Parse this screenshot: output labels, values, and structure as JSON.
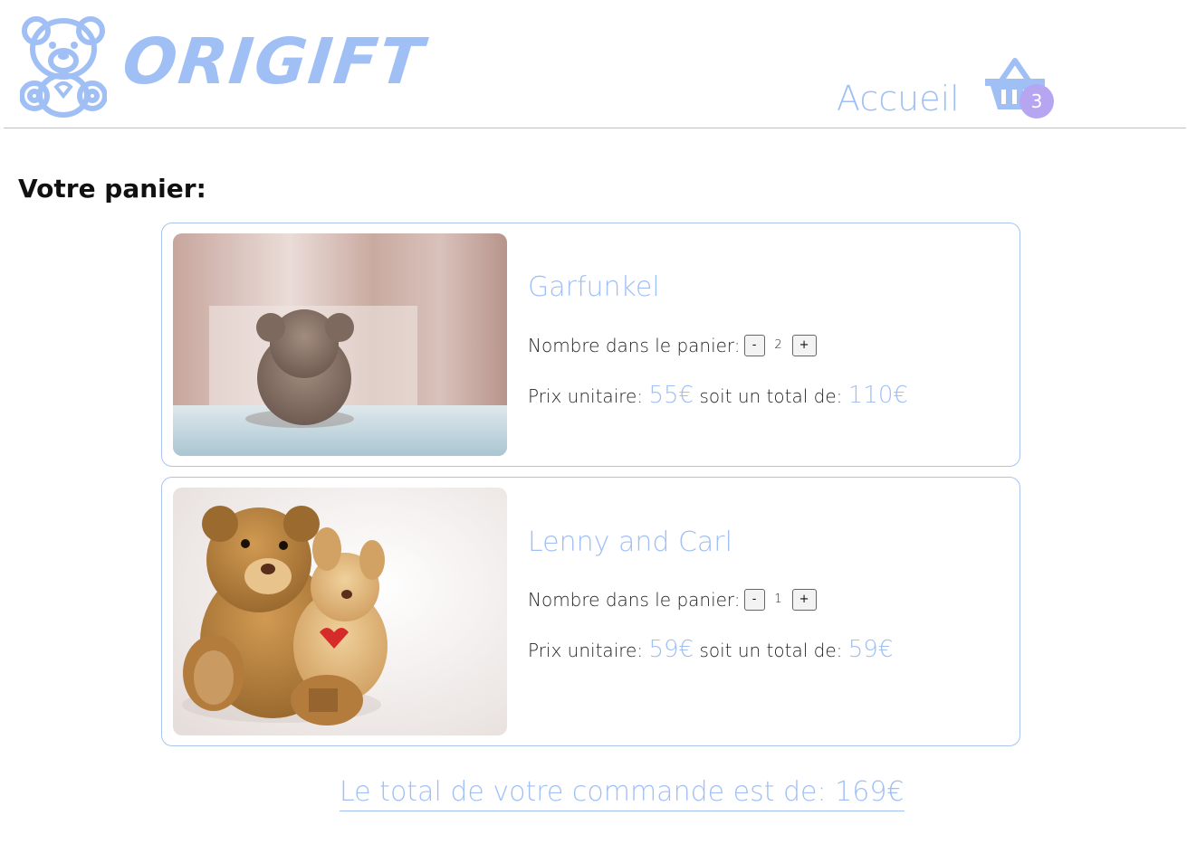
{
  "brand": {
    "name": "ORIGIFT",
    "logo_icon": "teddy-bear-icon",
    "color": "#9fbff5"
  },
  "nav": {
    "home_label": "Accueil",
    "cart_icon": "shopping-basket-icon",
    "cart_count": "3",
    "badge_color": "#b6a6f2"
  },
  "cart": {
    "title": "Votre panier:",
    "items": [
      {
        "name": "Garfunkel",
        "qty_label": "Nombre dans le panier:",
        "minus": "-",
        "qty": "2",
        "plus": "+",
        "unit_label": "Prix unitaire:",
        "unit_price": "55€",
        "total_label": "soit un total de:",
        "total_price": "110€",
        "image": "teddy-bear-sitting-on-bed-photo"
      },
      {
        "name": "Lenny and Carl",
        "qty_label": "Nombre dans le panier:",
        "minus": "-",
        "qty": "1",
        "plus": "+",
        "unit_label": "Prix unitaire:",
        "unit_price": "59€",
        "total_label": "soit un total de:",
        "total_price": "59€",
        "image": "teddy-bear-hugging-plush-photo"
      }
    ],
    "order_total": "Le total de votre commande est de: 169€"
  }
}
